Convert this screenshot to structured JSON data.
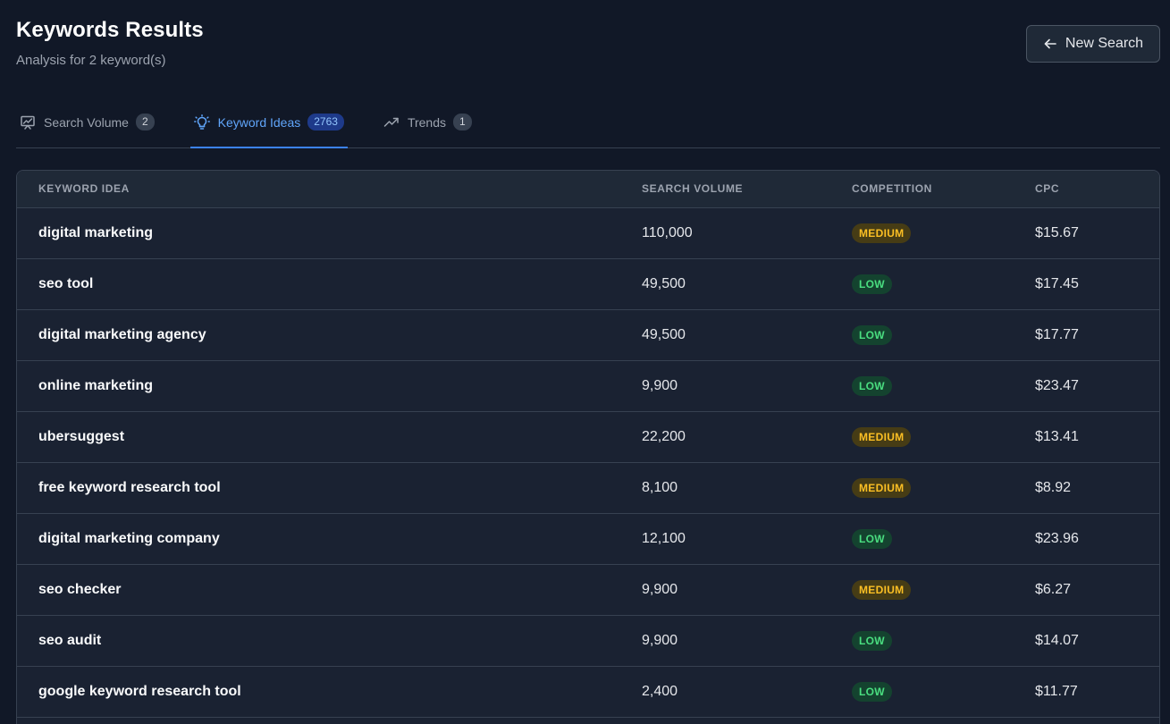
{
  "header": {
    "title": "Keywords Results",
    "subtitle": "Analysis for 2 keyword(s)",
    "new_search_label": "New Search"
  },
  "tabs": [
    {
      "label": "Search Volume",
      "count": "2",
      "icon": "chart-icon",
      "active": false
    },
    {
      "label": "Keyword Ideas",
      "count": "2763",
      "icon": "lightbulb-icon",
      "active": true
    },
    {
      "label": "Trends",
      "count": "1",
      "icon": "trending-up-icon",
      "active": false
    }
  ],
  "table": {
    "columns": [
      "KEYWORD IDEA",
      "SEARCH VOLUME",
      "COMPETITION",
      "CPC"
    ],
    "rows": [
      {
        "keyword": "digital marketing",
        "volume": "110,000",
        "competition": "MEDIUM",
        "cpc": "$15.67"
      },
      {
        "keyword": "seo tool",
        "volume": "49,500",
        "competition": "LOW",
        "cpc": "$17.45"
      },
      {
        "keyword": "digital marketing agency",
        "volume": "49,500",
        "competition": "LOW",
        "cpc": "$17.77"
      },
      {
        "keyword": "online marketing",
        "volume": "9,900",
        "competition": "LOW",
        "cpc": "$23.47"
      },
      {
        "keyword": "ubersuggest",
        "volume": "22,200",
        "competition": "MEDIUM",
        "cpc": "$13.41"
      },
      {
        "keyword": "free keyword research tool",
        "volume": "8,100",
        "competition": "MEDIUM",
        "cpc": "$8.92"
      },
      {
        "keyword": "digital marketing company",
        "volume": "12,100",
        "competition": "LOW",
        "cpc": "$23.96"
      },
      {
        "keyword": "seo checker",
        "volume": "9,900",
        "competition": "MEDIUM",
        "cpc": "$6.27"
      },
      {
        "keyword": "seo audit",
        "volume": "9,900",
        "competition": "LOW",
        "cpc": "$14.07"
      },
      {
        "keyword": "google keyword research tool",
        "volume": "2,400",
        "competition": "LOW",
        "cpc": "$11.77"
      }
    ]
  },
  "colors": {
    "background": "#111827",
    "accent": "#3b82f6",
    "medium": "#fbbf24",
    "low": "#4ade80"
  }
}
